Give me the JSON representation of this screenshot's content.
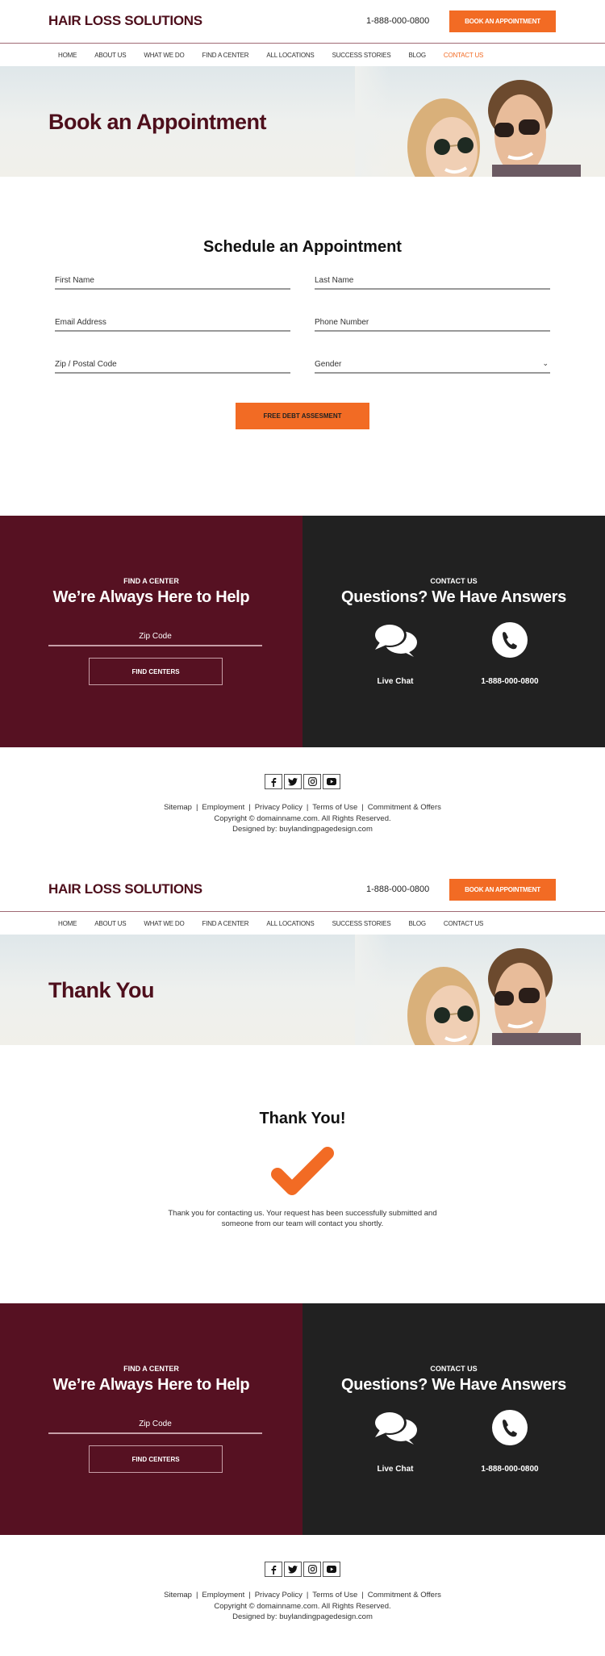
{
  "colors": {
    "brand": "#4e0f1c",
    "accent": "#f26b24",
    "maroon_panel": "#561122",
    "dark_panel": "#212121"
  },
  "header": {
    "logo": "HAIR LOSS SOLUTIONS",
    "phone": "1-888-000-0800",
    "book_button": "BOOK AN APPOINTMENT"
  },
  "nav": {
    "items": [
      {
        "label": "HOME"
      },
      {
        "label": "ABOUT US"
      },
      {
        "label": "WHAT WE DO"
      },
      {
        "label": "FIND A CENTER"
      },
      {
        "label": "ALL LOCATIONS"
      },
      {
        "label": "SUCCESS STORIES"
      },
      {
        "label": "BLOG"
      },
      {
        "label": "CONTACT US"
      }
    ]
  },
  "page1": {
    "hero_title": "Book an Appointment",
    "active_nav": "CONTACT US",
    "form": {
      "title": "Schedule an Appointment",
      "first_name_placeholder": "First Name",
      "last_name_placeholder": "Last Name",
      "email_placeholder": "Email Address",
      "phone_placeholder": "Phone Number",
      "zip_placeholder": "Zip / Postal Code",
      "gender_selected": "Gender",
      "submit_label": "FREE DEBT ASSESMENT"
    }
  },
  "page2": {
    "hero_title": "Thank You",
    "thanks_title": "Thank You!",
    "thanks_message": "Thank you for contacting us. Your request has been successfully submitted and someone from our team will contact you shortly."
  },
  "find_center": {
    "kicker": "FIND A CENTER",
    "heading": "We’re Always Here to Help",
    "zip_placeholder": "Zip Code",
    "button": "FIND CENTERS"
  },
  "contact": {
    "kicker": "CONTACT US",
    "heading": "Questions? We Have Answers",
    "chat_label": "Live Chat",
    "phone_label": "1-888-000-0800"
  },
  "footer": {
    "socials": [
      "facebook",
      "twitter",
      "instagram",
      "youtube"
    ],
    "links": [
      "Sitemap",
      "Employment",
      "Privacy Policy",
      "Terms of Use",
      "Commitment & Offers"
    ],
    "separator": "|",
    "copyright": "Copyright © domainname.com. All Rights Reserved.",
    "designed_by": "Designed by: buylandingpagedesign.com"
  }
}
